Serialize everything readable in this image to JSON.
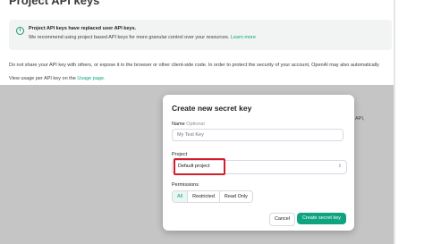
{
  "page": {
    "title": "Project API keys",
    "info": {
      "icon": "info-icon",
      "title": "Project API keys have replaced user API keys.",
      "body": "We recommend using project based API keys for more granular control over your resources.",
      "link_text": "Learn more"
    },
    "warning": "Do not share your API key with others, or expose it in the browser or other client-side code. In order to protect the security of your account, OpenAI may also automatically",
    "usage_prefix": "View usage per API key on the",
    "usage_link": "Usage page.",
    "bg_tail_text": "API,"
  },
  "modal": {
    "title": "Create new secret key",
    "name_label": "Name",
    "name_optional": "Optional",
    "name_placeholder": "My Test Key",
    "project_label": "Project",
    "project_value": "Default project",
    "permissions_label": "Permissions",
    "permissions": [
      "All",
      "Restricted",
      "Read Only"
    ],
    "permissions_selected": "All",
    "cancel_label": "Cancel",
    "create_label": "Create secret key"
  },
  "colors": {
    "accent": "#10a37f",
    "highlight": "#d11f2a"
  }
}
